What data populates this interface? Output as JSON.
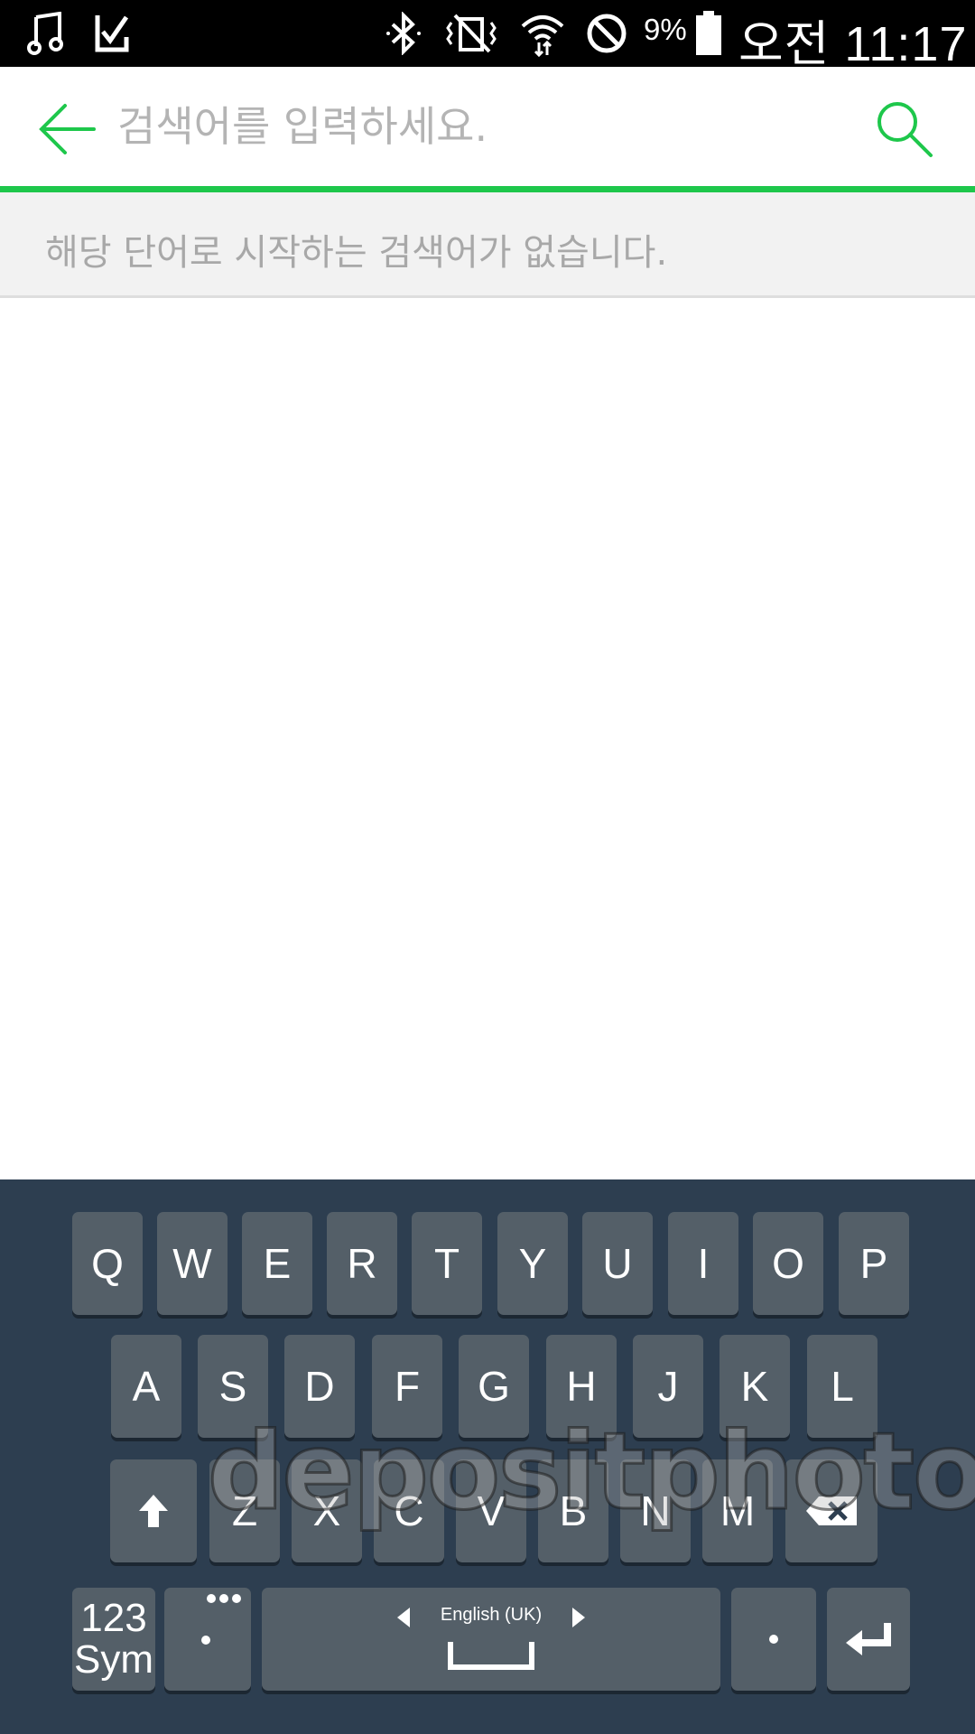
{
  "status_bar": {
    "battery_percent": "9%",
    "time": "오전 11:17",
    "icons": [
      "music-note-icon",
      "check-download-icon",
      "bluetooth-icon",
      "vibrate-icon",
      "wifi-icon",
      "no-sign-icon",
      "battery-icon"
    ]
  },
  "header": {
    "search_placeholder": "검색어를 입력하세요.",
    "search_value": "",
    "back_icon": "back-arrow-icon",
    "search_icon": "search-icon",
    "accent_color": "#1ec74b"
  },
  "suggestions": {
    "empty_message": "해당 단어로 시작하는 검색어가 없습니다."
  },
  "keyboard": {
    "row1": [
      "Q",
      "W",
      "E",
      "R",
      "T",
      "Y",
      "U",
      "I",
      "O",
      "P"
    ],
    "row2": [
      "A",
      "S",
      "D",
      "F",
      "G",
      "H",
      "J",
      "K",
      "L"
    ],
    "row3": [
      "Z",
      "X",
      "C",
      "V",
      "B",
      "N",
      "M"
    ],
    "sym_top": "123",
    "sym_bottom": "Sym",
    "space_language": "English (UK)",
    "period": "."
  },
  "watermark": "depositphotos"
}
